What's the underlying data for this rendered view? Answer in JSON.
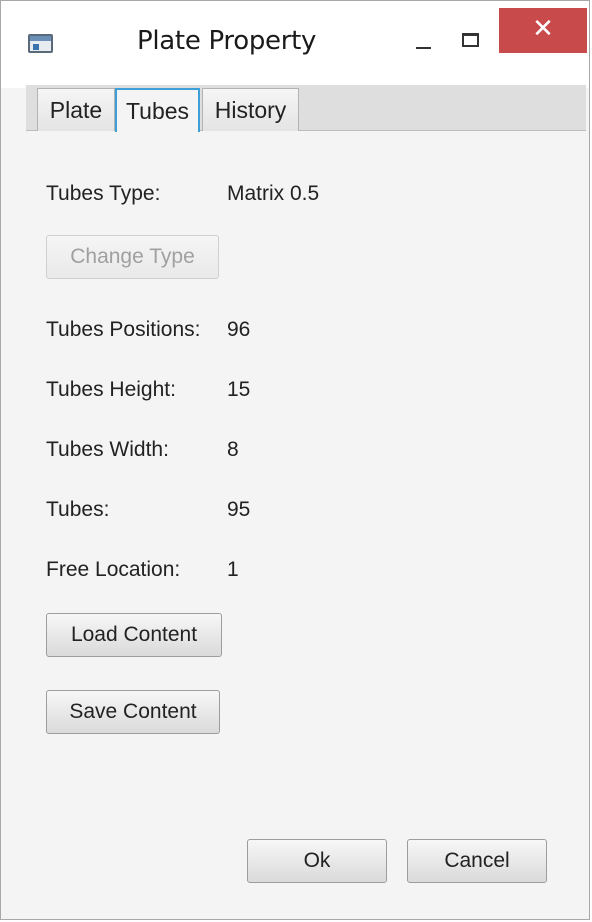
{
  "window": {
    "title": "Plate Property",
    "close_glyph": "✕"
  },
  "tabs": [
    {
      "label": "Plate",
      "active": false
    },
    {
      "label": "Tubes",
      "active": true
    },
    {
      "label": "History",
      "active": false
    }
  ],
  "properties": {
    "tubes_type": {
      "label": "Tubes Type:",
      "value": "Matrix 0.5"
    },
    "tubes_positions": {
      "label": "Tubes Positions:",
      "value": "96"
    },
    "tubes_height": {
      "label": "Tubes Height:",
      "value": "15"
    },
    "tubes_width": {
      "label": "Tubes Width:",
      "value": "8"
    },
    "tubes": {
      "label": "Tubes:",
      "value": "95"
    },
    "free_location": {
      "label": "Free Location:",
      "value": "1"
    }
  },
  "buttons": {
    "change_type": "Change Type",
    "load_content": "Load Content",
    "save_content": "Save Content",
    "ok": "Ok",
    "cancel": "Cancel"
  },
  "icons": {
    "app": "app-window-icon",
    "minimize": "minimize-icon",
    "maximize": "maximize-icon",
    "close": "close-icon"
  },
  "colors": {
    "close_button": "#c94a4b",
    "active_tab_border": "#3d9fd8",
    "content_background": "#f4f4f4"
  }
}
